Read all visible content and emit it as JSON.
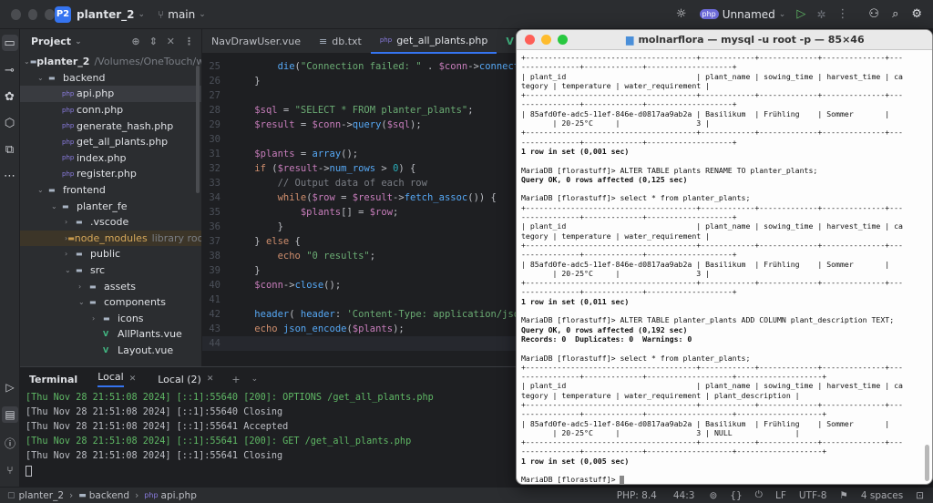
{
  "titlebar": {
    "project_badge": "P2",
    "project_name": "planter_2",
    "branch": "main",
    "run_config": "Unnamed",
    "php_badge": "php"
  },
  "project_panel": {
    "title": "Project",
    "tree": [
      {
        "label": "planter_2",
        "extra": "/Volumes/OneTouch/webde",
        "indent": 0,
        "type": "folder",
        "open": true
      },
      {
        "label": "backend",
        "indent": 1,
        "type": "folder",
        "open": true
      },
      {
        "label": "api.php",
        "indent": 2,
        "type": "php",
        "selected": true
      },
      {
        "label": "conn.php",
        "indent": 2,
        "type": "php"
      },
      {
        "label": "generate_hash.php",
        "indent": 2,
        "type": "php"
      },
      {
        "label": "get_all_plants.php",
        "indent": 2,
        "type": "php"
      },
      {
        "label": "index.php",
        "indent": 2,
        "type": "php"
      },
      {
        "label": "register.php",
        "indent": 2,
        "type": "php"
      },
      {
        "label": "frontend",
        "indent": 1,
        "type": "folder",
        "open": true
      },
      {
        "label": "planter_fe",
        "indent": 2,
        "type": "folder",
        "open": true
      },
      {
        "label": ".vscode",
        "indent": 3,
        "type": "folder"
      },
      {
        "label": "node_modules",
        "extra": "library root",
        "indent": 3,
        "type": "folder",
        "highlight": true
      },
      {
        "label": "public",
        "indent": 3,
        "type": "folder"
      },
      {
        "label": "src",
        "indent": 3,
        "type": "folder",
        "open": true
      },
      {
        "label": "assets",
        "indent": 4,
        "type": "folder"
      },
      {
        "label": "components",
        "indent": 4,
        "type": "folder",
        "open": true
      },
      {
        "label": "icons",
        "indent": 5,
        "type": "folder"
      },
      {
        "label": "AllPlants.vue",
        "indent": 5,
        "type": "vue"
      },
      {
        "label": "Layout.vue",
        "indent": 5,
        "type": "vue"
      }
    ]
  },
  "editor": {
    "tabs": [
      {
        "label": "NavDrawUser.vue",
        "icon": "vue"
      },
      {
        "label": "db.txt",
        "icon": "txt"
      },
      {
        "label": "get_all_plants.php",
        "icon": "php",
        "active": true
      },
      {
        "label": "P",
        "icon": "vue"
      }
    ],
    "lines": [
      {
        "n": "25",
        "t": "        die(\"Connection failed: \" . $conn->connect_erro"
      },
      {
        "n": "26",
        "t": "    }"
      },
      {
        "n": "27",
        "t": ""
      },
      {
        "n": "28",
        "t": "    $sql = \"SELECT * FROM planter_plants\";"
      },
      {
        "n": "29",
        "t": "    $result = $conn->query($sql);"
      },
      {
        "n": "30",
        "t": ""
      },
      {
        "n": "31",
        "t": "    $plants = array();"
      },
      {
        "n": "32",
        "t": "    if ($result->num_rows > 0) {"
      },
      {
        "n": "33",
        "t": "        // Output data of each row"
      },
      {
        "n": "34",
        "t": "        while($row = $result->fetch_assoc()) {"
      },
      {
        "n": "35",
        "t": "            $plants[] = $row;"
      },
      {
        "n": "36",
        "t": "        }"
      },
      {
        "n": "37",
        "t": "    } else {"
      },
      {
        "n": "38",
        "t": "        echo \"0 results\";"
      },
      {
        "n": "39",
        "t": "    }"
      },
      {
        "n": "40",
        "t": "    $conn->close();"
      },
      {
        "n": "41",
        "t": ""
      },
      {
        "n": "42",
        "t": "    header( header: 'Content-Type: application/json');"
      },
      {
        "n": "43",
        "t": "    echo json_encode($plants);"
      },
      {
        "n": "44",
        "t": ""
      }
    ]
  },
  "terminal": {
    "title": "Terminal",
    "tabs": [
      "Local",
      "Local (2)"
    ],
    "lines": [
      {
        "t": "[Thu Nov 28 21:51:08 2024] [::1]:55640 [200]: OPTIONS /get_all_plants.php",
        "c": "#5fb865"
      },
      {
        "t": "[Thu Nov 28 21:51:08 2024] [::1]:55640 Closing",
        "c": "#bcbec4"
      },
      {
        "t": "[Thu Nov 28 21:51:08 2024] [::1]:55641 Accepted",
        "c": "#bcbec4"
      },
      {
        "t": "[Thu Nov 28 21:51:08 2024] [::1]:55641 [200]: GET /get_all_plants.php",
        "c": "#5fb865"
      },
      {
        "t": "[Thu Nov 28 21:51:08 2024] [::1]:55641 Closing",
        "c": "#bcbec4"
      }
    ]
  },
  "mysql_window": {
    "title": "molnarflora — mysql -u root -p — 85×46",
    "lines": [
      "+--------------------------------------+------------+-------------+--------------+---",
      "-------------+-------------+-------------------+",
      "| plant_id                             | plant_name | sowing_time | harvest_time | ca",
      "tegory | temperature | water_requirement |",
      "+--------------------------------------+------------+-------------+--------------+---",
      "-------------+-------------+-------------------+",
      "| 85afd0fe-adc5-11ef-846e-d0817aa9ab2a | Basilikum  | Frühling    | Sommer       |",
      "       | 20-25°C     |                 3 |",
      "+--------------------------------------+------------+-------------+--------------+---",
      "-------------+-------------+-------------------+",
      "1 row in set (0,001 sec)",
      "",
      "MariaDB [florastuff]> ALTER TABLE plants RENAME TO planter_plants;",
      "Query OK, 0 rows affected (0,125 sec)",
      "",
      "MariaDB [florastuff]> select * from planter_plants;",
      "+--------------------------------------+------------+-------------+--------------+---",
      "-------------+-------------+-------------------+",
      "| plant_id                             | plant_name | sowing_time | harvest_time | ca",
      "tegory | temperature | water_requirement |",
      "+--------------------------------------+------------+-------------+--------------+---",
      "-------------+-------------+-------------------+",
      "| 85afd0fe-adc5-11ef-846e-d0817aa9ab2a | Basilikum  | Frühling    | Sommer       |",
      "       | 20-25°C     |                 3 |",
      "+--------------------------------------+------------+-------------+--------------+---",
      "-------------+-------------+-------------------+",
      "1 row in set (0,011 sec)",
      "",
      "MariaDB [florastuff]> ALTER TABLE planter_plants ADD COLUMN plant_description TEXT;",
      "Query OK, 0 rows affected (0,192 sec)",
      "Records: 0  Duplicates: 0  Warnings: 0",
      "",
      "MariaDB [florastuff]> select * from planter_plants;",
      "+--------------------------------------+------------+-------------+--------------+---",
      "-------------+-------------+-------------------+-------------------+",
      "| plant_id                             | plant_name | sowing_time | harvest_time | ca",
      "tegory | temperature | water_requirement | plant_description |",
      "+--------------------------------------+------------+-------------+--------------+---",
      "-------------+-------------+-------------------+-------------------+",
      "| 85afd0fe-adc5-11ef-846e-d0817aa9ab2a | Basilikum  | Frühling    | Sommer       |",
      "       | 20-25°C     |                 3 | NULL              |",
      "+--------------------------------------+------------+-------------+--------------+---",
      "-------------+-------------+-------------------+-------------------+",
      "1 row in set (0,005 sec)",
      "",
      "MariaDB [florastuff]> "
    ]
  },
  "statusbar": {
    "breadcrumb": [
      "planter_2",
      "backend",
      "api.php"
    ],
    "php_version": "PHP: 8.4",
    "position": "44:3",
    "line_sep": "LF",
    "encoding": "UTF-8",
    "indent": "4 spaces"
  },
  "colors": {
    "accent": "#3574f0",
    "php_purple": "#8a7ce0",
    "vue_green": "#42b883",
    "folder": "#a9b4c3"
  }
}
